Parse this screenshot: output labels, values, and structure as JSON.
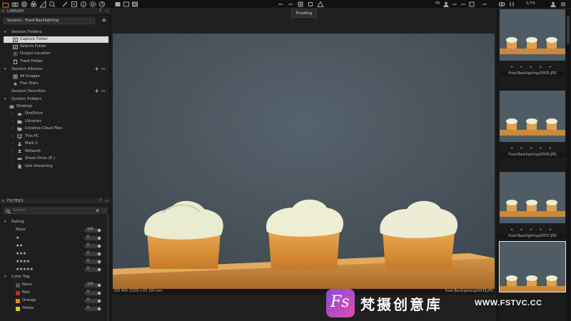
{
  "toolbar": {
    "fit_label": "Fit",
    "counter": "1/74",
    "proofing_label": "Proofing"
  },
  "library": {
    "title": "LIBRARY",
    "session_label": "Session : Food Backlighting",
    "session_folders": {
      "title": "Session Folders",
      "items": [
        {
          "label": "Capture Folder",
          "icon": "folder-capture-icon"
        },
        {
          "label": "Selects Folder",
          "icon": "folder-selects-icon"
        },
        {
          "label": "Output Location",
          "icon": "output-gear-icon"
        },
        {
          "label": "Trash Folder",
          "icon": "trash-icon"
        }
      ]
    },
    "session_albums": {
      "title": "Session Albums",
      "items": [
        {
          "label": "All Images",
          "icon": "album-icon"
        },
        {
          "label": "Five Stars",
          "icon": "smart-album-icon"
        }
      ]
    },
    "session_favorites": {
      "title": "Session Favorites"
    },
    "system_folders": {
      "title": "System Folders",
      "root": "Desktop",
      "items": [
        {
          "label": "OneDrive",
          "icon": "cloud-icon"
        },
        {
          "label": "Libraries",
          "icon": "folder-icon"
        },
        {
          "label": "Creative Cloud Files",
          "icon": "folder-icon"
        },
        {
          "label": "This PC",
          "icon": "computer-icon"
        },
        {
          "label": "Mark C",
          "icon": "user-icon"
        },
        {
          "label": "Network",
          "icon": "network-icon"
        },
        {
          "label": "Shoot Drive (E:)",
          "icon": "drive-icon"
        },
        {
          "label": "test streaming",
          "icon": "file-icon"
        }
      ]
    }
  },
  "filters": {
    "title": "FILTERS",
    "search_placeholder": "Search",
    "rating": {
      "title": "Rating",
      "rows": [
        {
          "label": "None",
          "stars": "",
          "count": "150"
        },
        {
          "label": "",
          "stars": "★",
          "count": "0"
        },
        {
          "label": "",
          "stars": "★★",
          "count": "0"
        },
        {
          "label": "",
          "stars": "★★★",
          "count": "0"
        },
        {
          "label": "",
          "stars": "★★★★",
          "count": "0"
        },
        {
          "label": "",
          "stars": "★★★★★",
          "count": "0"
        }
      ]
    },
    "color_tag": {
      "title": "Color Tag",
      "rows": [
        {
          "label": "None",
          "color": "#555555",
          "count": "150"
        },
        {
          "label": "Red",
          "color": "#c0282a",
          "count": "0"
        },
        {
          "label": "Orange",
          "color": "#d98a1e",
          "count": "0"
        },
        {
          "label": "Yellow",
          "color": "#d9c81e",
          "count": "0"
        }
      ]
    }
  },
  "viewer": {
    "info_left": "ISO 400  1/100 s  f/5  100 mm",
    "info_right": "Food Backlighting20938.JPG"
  },
  "filmstrip": {
    "thumbs": [
      {
        "filename": "Food Backlighting20935.JPG",
        "selected": false
      },
      {
        "filename": "Food Backlighting20936.JPG",
        "selected": false
      },
      {
        "filename": "Food Backlighting20937.JPG",
        "selected": false
      },
      {
        "filename": "",
        "selected": true
      }
    ],
    "dots": "• • • • •"
  },
  "watermark": {
    "logo_text": "Fs",
    "chinese_text": "梵摄创意库",
    "url_text": "WWW.FSTVC.CC"
  },
  "colors": {
    "accent": "#e07a1f",
    "selection_bg": "#d9d9d9",
    "photo_background": "#4d5963",
    "board": "#c98a3c"
  }
}
